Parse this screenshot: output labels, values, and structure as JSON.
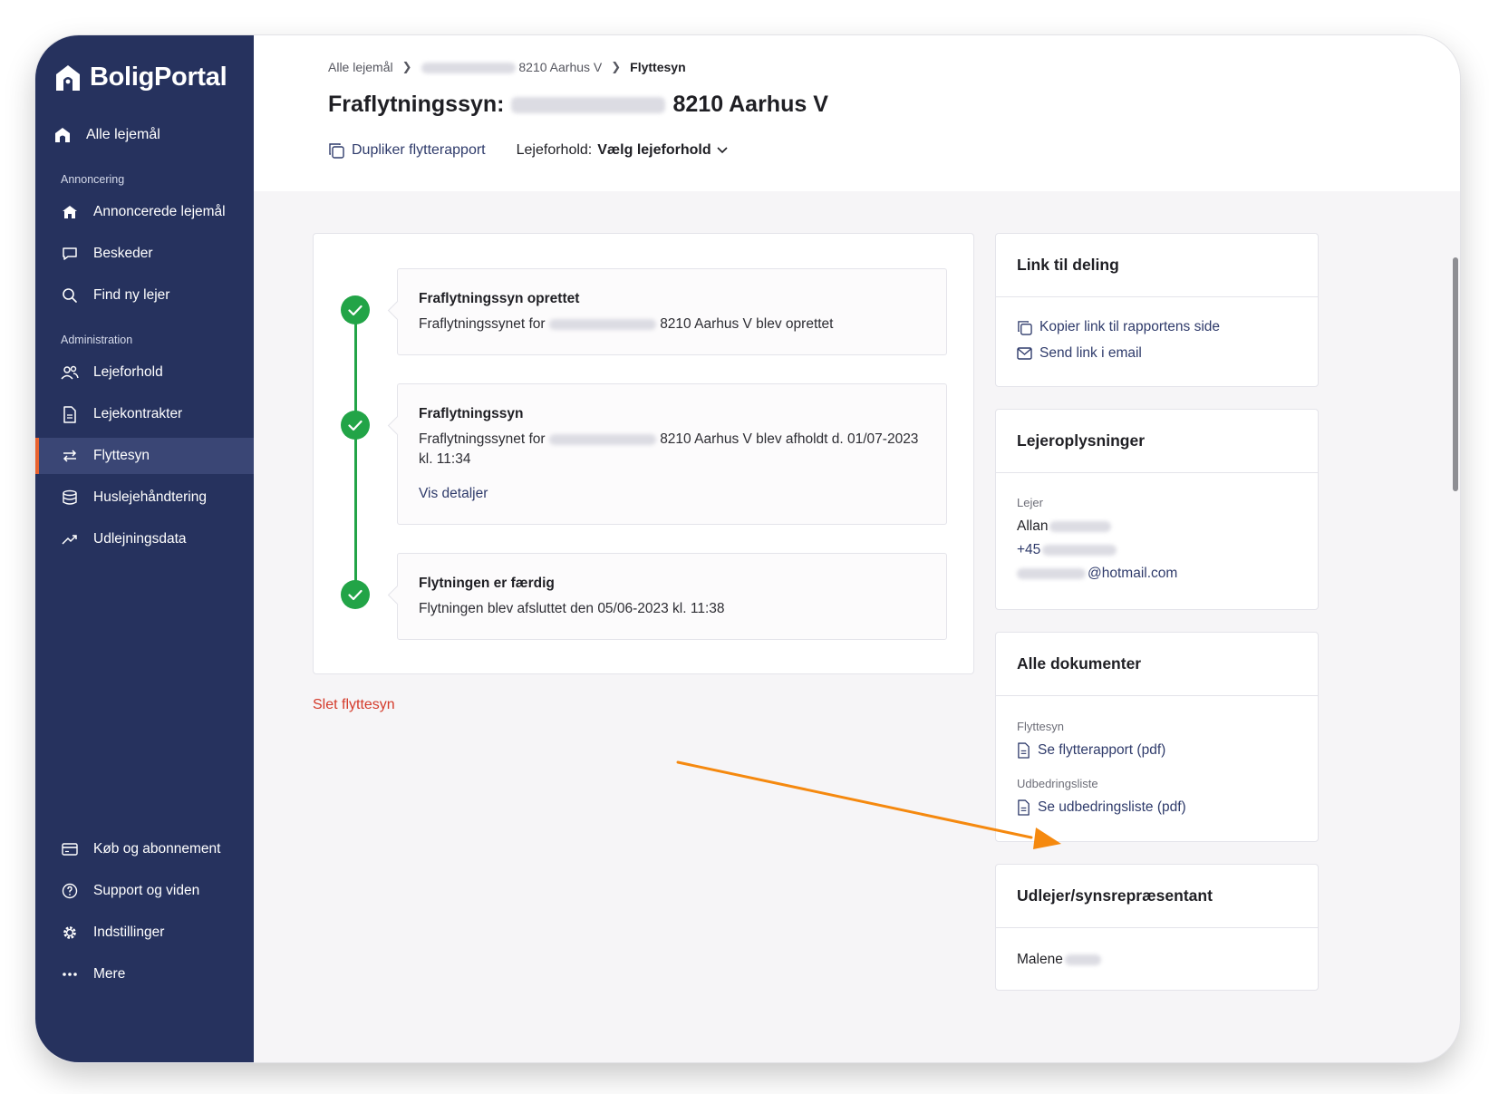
{
  "brand": {
    "name": "BoligPortal"
  },
  "sidebar": {
    "top_item": "Alle lejemål",
    "section_annoncering": "Annoncering",
    "section_administration": "Administration",
    "items": [
      {
        "label": "Annoncerede lejemål",
        "icon": "house-icon"
      },
      {
        "label": "Beskeder",
        "icon": "chat-bubble-icon"
      },
      {
        "label": "Find ny lejer",
        "icon": "search-icon"
      },
      {
        "label": "Lejeforhold",
        "icon": "users-icon"
      },
      {
        "label": "Lejekontrakter",
        "icon": "document-icon"
      },
      {
        "label": "Flyttesyn",
        "icon": "swap-arrows-icon",
        "active": true
      },
      {
        "label": "Huslejehåndtering",
        "icon": "coins-icon"
      },
      {
        "label": "Udlejningsdata",
        "icon": "trending-icon"
      }
    ],
    "bottom_items": [
      {
        "label": "Køb og abonnement",
        "icon": "credit-card-icon"
      },
      {
        "label": "Support og viden",
        "icon": "help-circle-icon"
      },
      {
        "label": "Indstillinger",
        "icon": "gear-icon"
      },
      {
        "label": "Mere",
        "icon": "more-dots-icon"
      }
    ]
  },
  "header": {
    "breadcrumb": {
      "first": "Alle lejemål",
      "second": "8210 Aarhus V",
      "current": "Flyttesyn"
    },
    "title_prefix": "Fraflytningssyn:",
    "title_suffix": "8210 Aarhus V",
    "duplicate_label": "Dupliker flytterapport",
    "tenancy_label": "Lejeforhold:",
    "tenancy_value": "Vælg lejeforhold"
  },
  "timeline": {
    "events": [
      {
        "title": "Fraflytningssyn oprettet",
        "text_prefix": "Fraflytningssynet for",
        "text_suffix": "8210 Aarhus V blev oprettet"
      },
      {
        "title": "Fraflytningssyn",
        "text_prefix": "Fraflytningssynet for",
        "text_suffix": "8210 Aarhus V blev afholdt d. 01/07-2023",
        "text_line2": "kl. 11:34",
        "link": "Vis detaljer"
      },
      {
        "title": "Flytningen er færdig",
        "text": "Flytningen blev afsluttet den 05/06-2023 kl. 11:38"
      }
    ]
  },
  "delete_label": "Slet flyttesyn",
  "share_card": {
    "title": "Link til deling",
    "copy_link": "Kopier link til rapportens side",
    "email_link": "Send link i email"
  },
  "tenant_card": {
    "title": "Lejeroplysninger",
    "label": "Lejer",
    "first_name": "Allan",
    "phone_prefix": "+45",
    "email_suffix": "@hotmail.com"
  },
  "documents_card": {
    "title": "Alle dokumenter",
    "group1_label": "Flyttesyn",
    "group1_link": "Se flytterapport (pdf)",
    "group2_label": "Udbedringsliste",
    "group2_link": "Se udbedringsliste (pdf)"
  },
  "landlord_card": {
    "title": "Udlejer/synsrepræsentant",
    "first_name": "Malene"
  },
  "colors": {
    "sidebar_bg": "#26325e",
    "active_accent": "#e8622f",
    "success_green": "#22a447",
    "link_blue": "#2f3b6b",
    "danger_red": "#d43a2a",
    "annotation_arrow": "#f5890f"
  }
}
